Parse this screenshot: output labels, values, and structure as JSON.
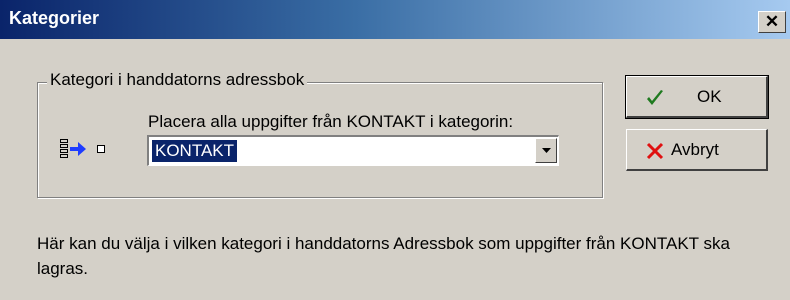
{
  "window": {
    "title": "Kategorier"
  },
  "group": {
    "legend": "Kategori i handdatorns adressbok",
    "instruction": "Placera alla uppgifter från KONTAKT i kategorin:",
    "category_select": {
      "value": "KONTAKT"
    },
    "icon": "list-to-category-icon"
  },
  "buttons": {
    "ok": {
      "label": "OK",
      "icon": "checkmark-icon",
      "icon_color": "#1f7a1f"
    },
    "cancel": {
      "label": "Avbryt",
      "icon": "x-icon",
      "icon_color": "#e01010"
    }
  },
  "help_text": "Här kan du välja i vilken kategori i handdatorns Adressbok som uppgifter från KONTAKT ska lagras.",
  "colors": {
    "titlebar_start": "#0a246a",
    "titlebar_end": "#a6caf0",
    "selection": "#0a246a"
  }
}
